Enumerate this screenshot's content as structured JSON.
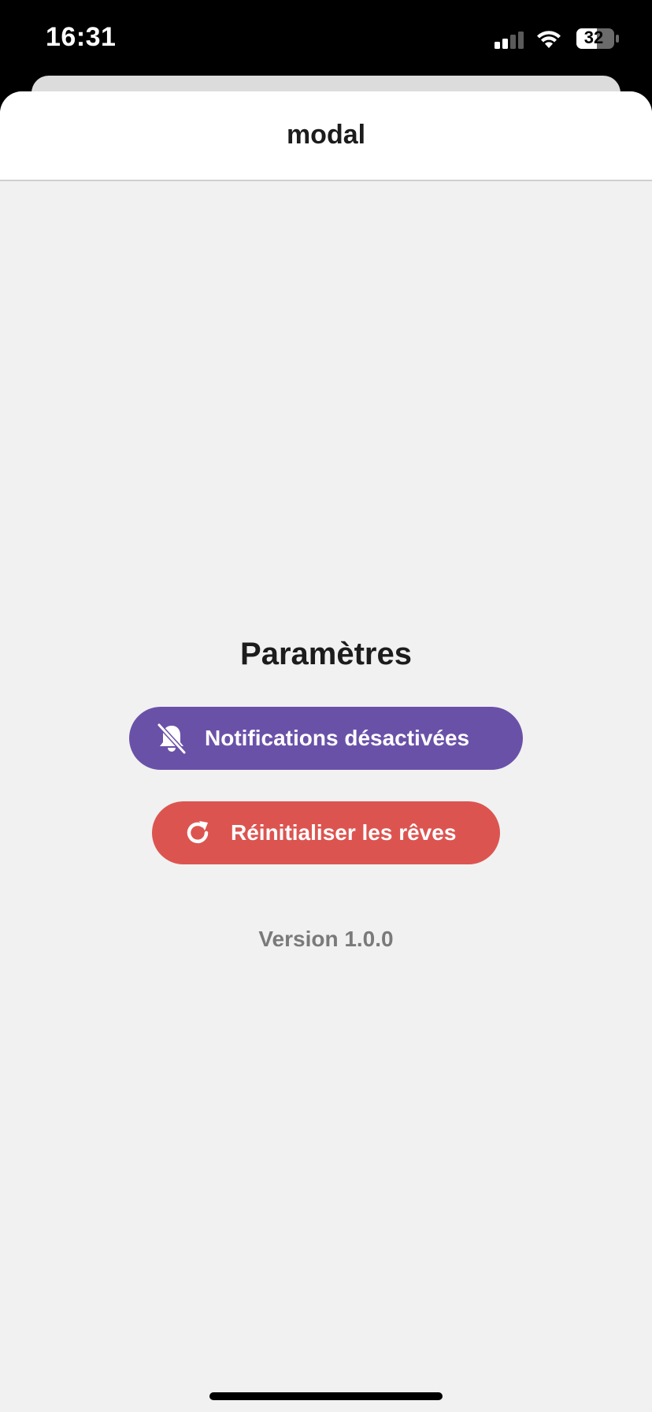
{
  "status_bar": {
    "time": "16:31",
    "battery_level": "32",
    "signal_icon": "cellular-signal-icon",
    "wifi_icon": "wifi-icon",
    "battery_icon": "battery-icon"
  },
  "modal": {
    "title": "modal"
  },
  "settings": {
    "heading": "Paramètres",
    "notifications_button": {
      "label": "Notifications désactivées",
      "icon": "bell-slash-icon",
      "color": "#6a51a8"
    },
    "reset_button": {
      "label": "Réinitialiser les rêves",
      "icon": "refresh-icon",
      "color": "#dc5450"
    },
    "version": "Version 1.0.0"
  }
}
